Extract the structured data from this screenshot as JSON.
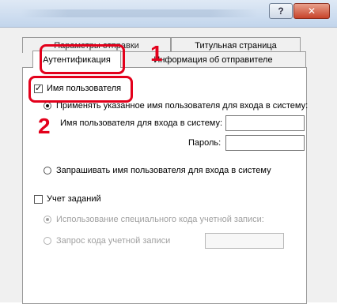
{
  "window": {
    "title": "",
    "help_label": "?",
    "close_label": "✕"
  },
  "tabs": {
    "send_settings": "Параметры отправки",
    "title_page": "Титульная страница",
    "authentication": "Аутентификация",
    "sender_info": "Информация об отправителе"
  },
  "auth": {
    "username_checkbox_label": "Имя пользователя",
    "username_checked": true,
    "apply_radio_label": "Применять указанное имя пользователя для входа в систему:",
    "login_name_label": "Имя пользователя для входа в систему:",
    "login_name_value": "",
    "password_label": "Пароль:",
    "password_value": "",
    "ask_radio_label": "Запрашивать имя пользователя для входа в систему"
  },
  "job_accounting": {
    "checkbox_label": "Учет заданий",
    "checked": false,
    "use_code_label": "Использование специального кода учетной записи:",
    "request_code_label": "Запрос кода учетной записи",
    "code_value": ""
  },
  "callouts": {
    "step1": "1",
    "step2": "2",
    "color": "#e3001b"
  }
}
